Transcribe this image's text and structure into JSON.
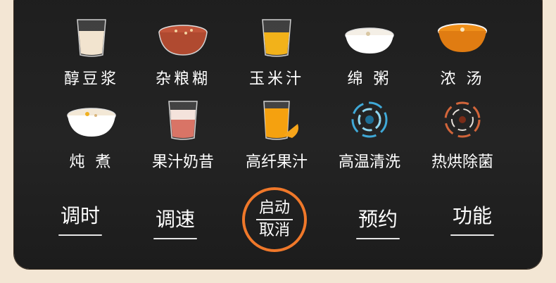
{
  "colors": {
    "background": "#f3e6d4",
    "panel": "#1e1e1e",
    "accent_orange": "#f0782a",
    "text": "#ffffff"
  },
  "programs": [
    {
      "label": "醇豆浆",
      "icon": "soy-milk-glass-icon"
    },
    {
      "label": "杂粮糊",
      "icon": "grain-paste-bowl-icon"
    },
    {
      "label": "玉米汁",
      "icon": "corn-juice-glass-icon"
    },
    {
      "label": "绵 粥",
      "icon": "porridge-bowl-icon"
    },
    {
      "label": "浓 汤",
      "icon": "thick-soup-bowl-icon"
    },
    {
      "label": "炖 煮",
      "icon": "stew-bowl-icon"
    },
    {
      "label": "果汁奶昔",
      "icon": "juice-milkshake-glass-icon"
    },
    {
      "label": "高纤果汁",
      "icon": "orange-juice-glass-icon"
    },
    {
      "label": "高温清洗",
      "icon": "water-swirl-icon"
    },
    {
      "label": "热烘除菌",
      "icon": "heat-swirl-icon"
    }
  ],
  "controls": {
    "timer": "调时",
    "speed": "调速",
    "start_line1": "启动",
    "start_line2": "取消",
    "schedule": "预约",
    "function": "功能"
  }
}
